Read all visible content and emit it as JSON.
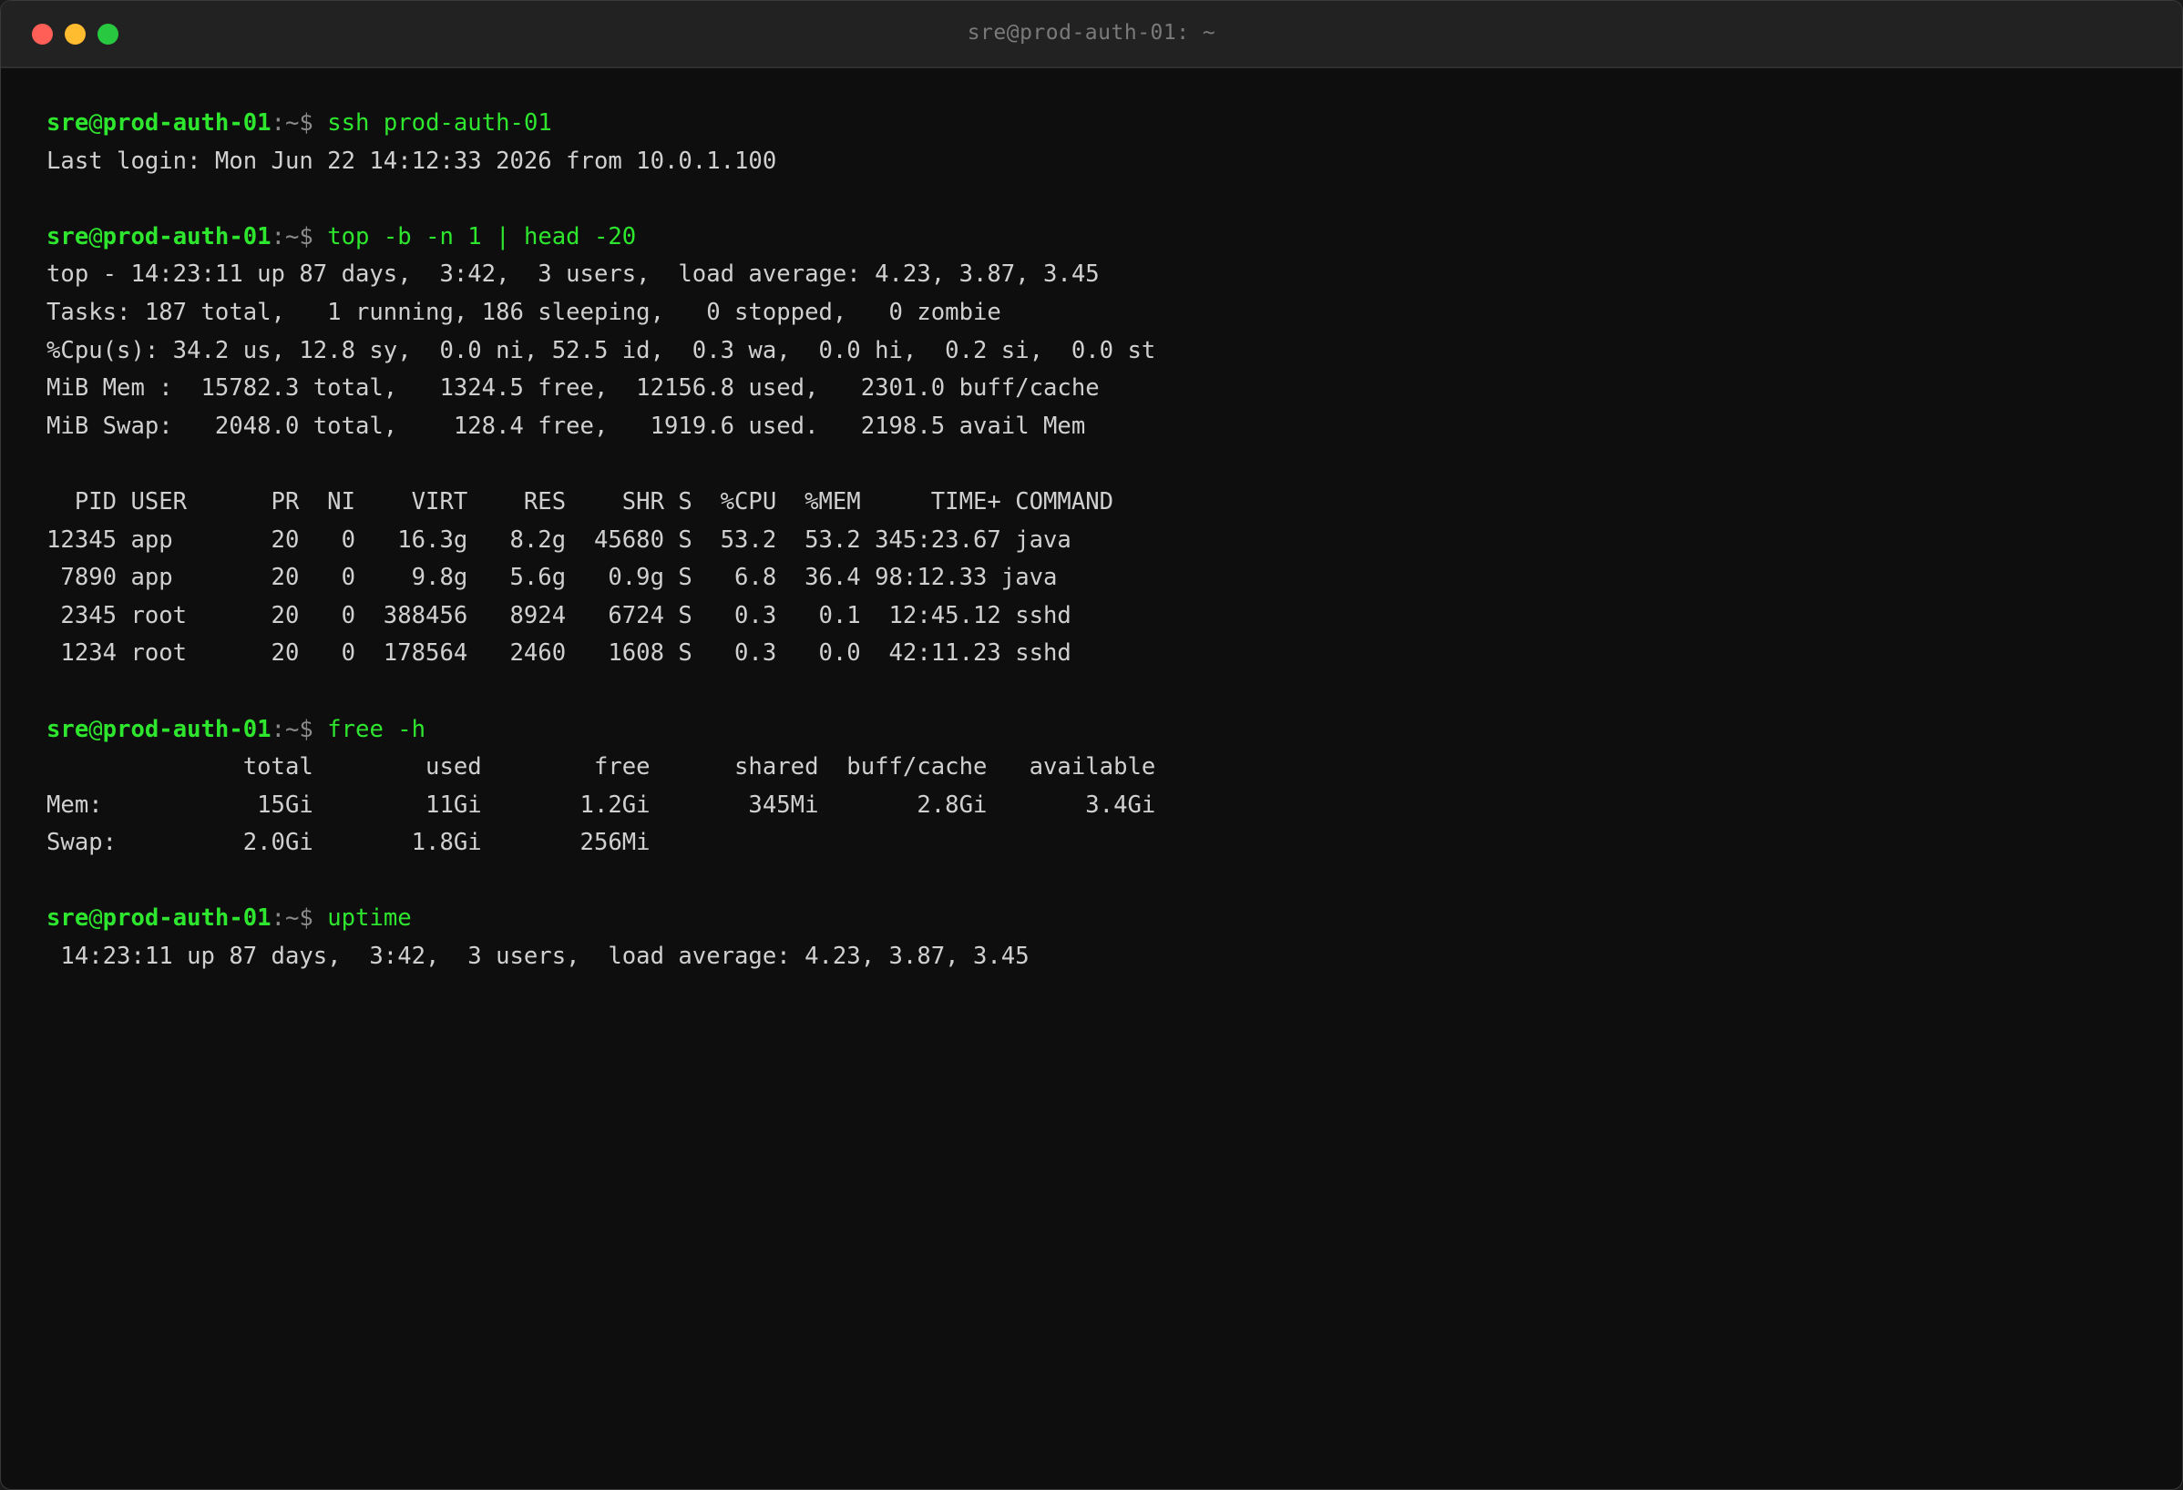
{
  "window": {
    "title": "sre@prod-auth-01: ~"
  },
  "prompt": {
    "user": "sre",
    "at": "@",
    "host": "prod-auth-01",
    "path": ":~$"
  },
  "session": [
    {
      "command": "ssh prod-auth-01",
      "output": [
        "Last login: Mon Jun 22 14:12:33 2026 from 10.0.1.100"
      ]
    },
    {
      "command": "top -b -n 1 | head -20",
      "output": [
        "top - 14:23:11 up 87 days,  3:42,  3 users,  load average: 4.23, 3.87, 3.45",
        "Tasks: 187 total,   1 running, 186 sleeping,   0 stopped,   0 zombie",
        "%Cpu(s): 34.2 us, 12.8 sy,  0.0 ni, 52.5 id,  0.3 wa,  0.0 hi,  0.2 si,  0.0 st",
        "MiB Mem :  15782.3 total,   1324.5 free,  12156.8 used,   2301.0 buff/cache",
        "MiB Swap:   2048.0 total,    128.4 free,   1919.6 used.   2198.5 avail Mem",
        "",
        "  PID USER      PR  NI    VIRT    RES    SHR S  %CPU  %MEM     TIME+ COMMAND",
        "12345 app       20   0   16.3g   8.2g  45680 S  53.2  53.2 345:23.67 java",
        " 7890 app       20   0    9.8g   5.6g   0.9g S   6.8  36.4 98:12.33 java",
        " 2345 root      20   0  388456   8924   6724 S   0.3   0.1  12:45.12 sshd",
        " 1234 root      20   0  178564   2460   1608 S   0.3   0.0  42:11.23 sshd"
      ]
    },
    {
      "command": "free -h",
      "output": [
        "              total        used        free      shared  buff/cache   available",
        "Mem:           15Gi        11Gi       1.2Gi       345Mi       2.8Gi       3.4Gi",
        "Swap:         2.0Gi       1.8Gi       256Mi"
      ]
    },
    {
      "command": "uptime",
      "output": [
        " 14:23:11 up 87 days,  3:42,  3 users,  load average: 4.23, 3.87, 3.45"
      ]
    }
  ]
}
